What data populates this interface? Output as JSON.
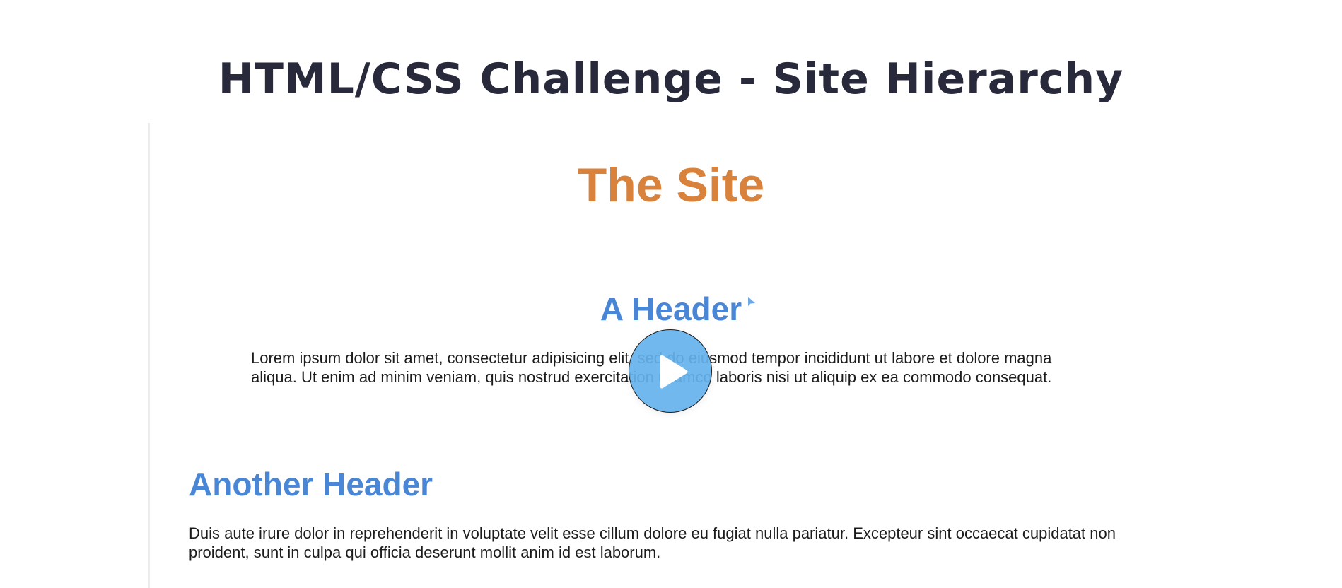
{
  "page": {
    "title": "HTML/CSS Challenge - Site Hierarchy"
  },
  "preview": {
    "site_title": "The Site",
    "sections": [
      {
        "header": "A Header",
        "body": "Lorem ipsum dolor sit amet, consectetur adipisicing elit, sed do eiusmod tempor incididunt ut labore et dolore magna aliqua. Ut enim ad minim veniam, quis nostrud exercitation ullamco laboris nisi ut aliquip ex ea commodo consequat."
      },
      {
        "header": "Another Header",
        "body": "Duis aute irure dolor in reprehenderit in voluptate velit esse cillum dolore eu fugiat nulla pariatur. Excepteur sint occaecat cupidatat non proident, sunt in culpa qui officia deserunt mollit anim id est laborum."
      }
    ]
  },
  "player": {
    "play_icon": "play-icon",
    "cursor_icon": "pointer-cursor-icon"
  },
  "colors": {
    "page_title": "#282a3c",
    "site_title": "#d9823b",
    "section_header": "#4a86d6",
    "play_button": "#64b2ec",
    "frame_border": "#ececee"
  }
}
